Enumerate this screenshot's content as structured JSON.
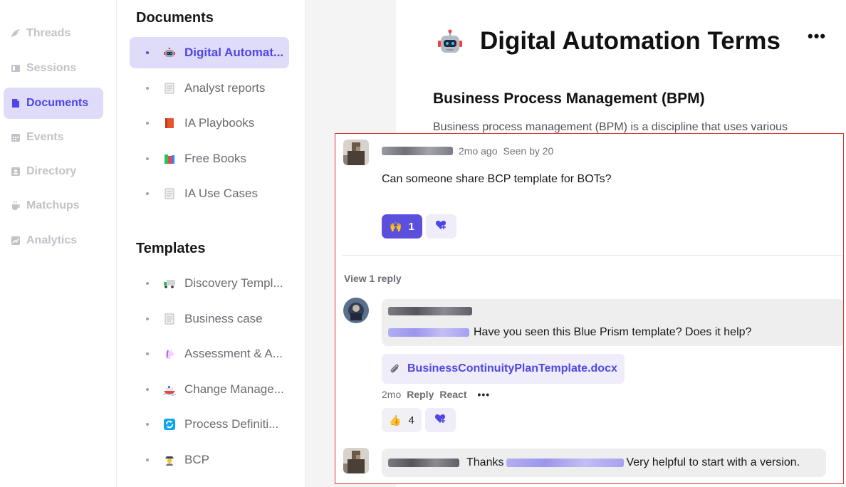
{
  "nav": {
    "items": [
      {
        "label": "Threads",
        "icon": "feather-icon"
      },
      {
        "label": "Sessions",
        "icon": "sessions-icon"
      },
      {
        "label": "Documents",
        "icon": "document-icon"
      },
      {
        "label": "Events",
        "icon": "calendar-icon"
      },
      {
        "label": "Directory",
        "icon": "contact-card-icon"
      },
      {
        "label": "Matchups",
        "icon": "coffee-cup-icon"
      },
      {
        "label": "Analytics",
        "icon": "chart-icon"
      }
    ],
    "active": "Documents"
  },
  "docs_panel": {
    "documents_title": "Documents",
    "documents": [
      {
        "label": "Digital Automat...",
        "icon": "robot-icon"
      },
      {
        "label": "Analyst reports",
        "icon": "page-icon"
      },
      {
        "label": "IA Playbooks",
        "icon": "book-icon"
      },
      {
        "label": "Free Books",
        "icon": "books-icon"
      },
      {
        "label": "IA Use Cases",
        "icon": "page-icon"
      }
    ],
    "templates_title": "Templates",
    "templates": [
      {
        "label": "Discovery Templ...",
        "icon": "truck-icon"
      },
      {
        "label": "Business case",
        "icon": "page-icon"
      },
      {
        "label": "Assessment & A...",
        "icon": "unicorn-icon"
      },
      {
        "label": "Change Manage...",
        "icon": "ship-icon"
      },
      {
        "label": "Process Definiti...",
        "icon": "refresh-icon"
      },
      {
        "label": "BCP",
        "icon": "detective-icon"
      }
    ]
  },
  "document": {
    "title": "Digital Automation Terms",
    "more": "•••",
    "heading": "Business Process Management (BPM)",
    "paragraph": "Business process management (BPM) is a discipline that uses various"
  },
  "thread": {
    "post": {
      "time": "2mo ago",
      "seen": "Seen by 20",
      "message": "Can someone share BCP template for BOTs?",
      "reaction_emoji": "🙌",
      "reaction_count": "1"
    },
    "view_replies": "View 1 reply",
    "reply": {
      "message": "Have you seen this Blue Prism template? Does it help?",
      "attachment": "BusinessContinuityPlanTemplate.docx",
      "time": "2mo",
      "reply_label": "Reply",
      "react_label": "React",
      "more": "•••",
      "reaction_emoji": "👍",
      "reaction_count": "4"
    },
    "last": {
      "prefix": "Thanks",
      "suffix": "Very helpful to start with a version."
    }
  },
  "colors": {
    "accent": "#4f46e5",
    "accent_bg": "#dedcf8",
    "thread_border": "#d63a3a"
  }
}
